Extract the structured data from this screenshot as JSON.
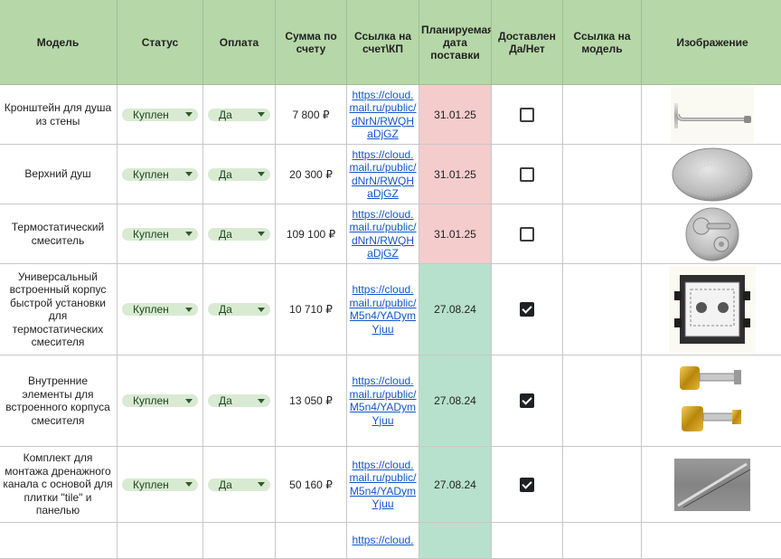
{
  "columns": [
    "Модель",
    "Статус",
    "Оплата",
    "Сумма по счету",
    "Ссылка на счет\\КП",
    "Планируемая дата поставки",
    "Доставлен Да/Нет",
    "Ссылка на модель",
    "Изображение"
  ],
  "rows": [
    {
      "model": "Кронштейн для душа из стены",
      "status": "Куплен",
      "payment": "Да",
      "sum": "7 800 ₽",
      "link": "https://cloud.mail.ru/public/dNrN/RWQHaDjGZ",
      "date": "31.01.25",
      "date_color": "#f4cccc",
      "delivered": false,
      "image": "shower-arm-image"
    },
    {
      "model": "Верхний душ",
      "status": "Куплен",
      "payment": "Да",
      "sum": "20 300 ₽",
      "link": "https://cloud.mail.ru/public/dNrN/RWQHaDjGZ",
      "date": "31.01.25",
      "date_color": "#f4cccc",
      "delivered": false,
      "image": "rain-shower-head-image"
    },
    {
      "model": "Термостатический смеситель",
      "status": "Куплен",
      "payment": "Да",
      "sum": "109 100 ₽",
      "link": "https://cloud.mail.ru/public/dNrN/RWQHaDjGZ",
      "date": "31.01.25",
      "date_color": "#f4cccc",
      "delivered": false,
      "image": "thermostatic-mixer-image"
    },
    {
      "model": "Универсальный встроенный корпус быстрой установки для термостатических смесителя",
      "status": "Куплен",
      "payment": "Да",
      "sum": "10 710 ₽",
      "link": "https://cloud.mail.ru/public/M5n4/YADymYjuu",
      "date": "27.08.24",
      "date_color": "#b7e1cd",
      "delivered": true,
      "image": "concealed-body-image"
    },
    {
      "model": "Внутренние элементы для встроенного корпуса смесителя",
      "status": "Куплен",
      "payment": "Да",
      "sum": "13 050 ₽",
      "link": "https://cloud.mail.ru/public/M5n4/YADymYjuu",
      "date": "27.08.24",
      "date_color": "#b7e1cd",
      "delivered": true,
      "image": "brass-valves-image"
    },
    {
      "model": "Комплект для монтажа дренажного канала с основой для плитки \"tile\" и панелью",
      "status": "Куплен",
      "payment": "Да",
      "sum": "50 160 ₽",
      "link": "https://cloud.mail.ru/public/M5n4/YADymYjuu",
      "date": "27.08.24",
      "date_color": "#b7e1cd",
      "delivered": true,
      "image": "drain-channel-image"
    },
    {
      "model": "",
      "status": "",
      "payment": "",
      "sum": "",
      "link": "https://cloud.",
      "date": "",
      "date_color": "#b7e1cd",
      "delivered": false,
      "image": ""
    }
  ]
}
